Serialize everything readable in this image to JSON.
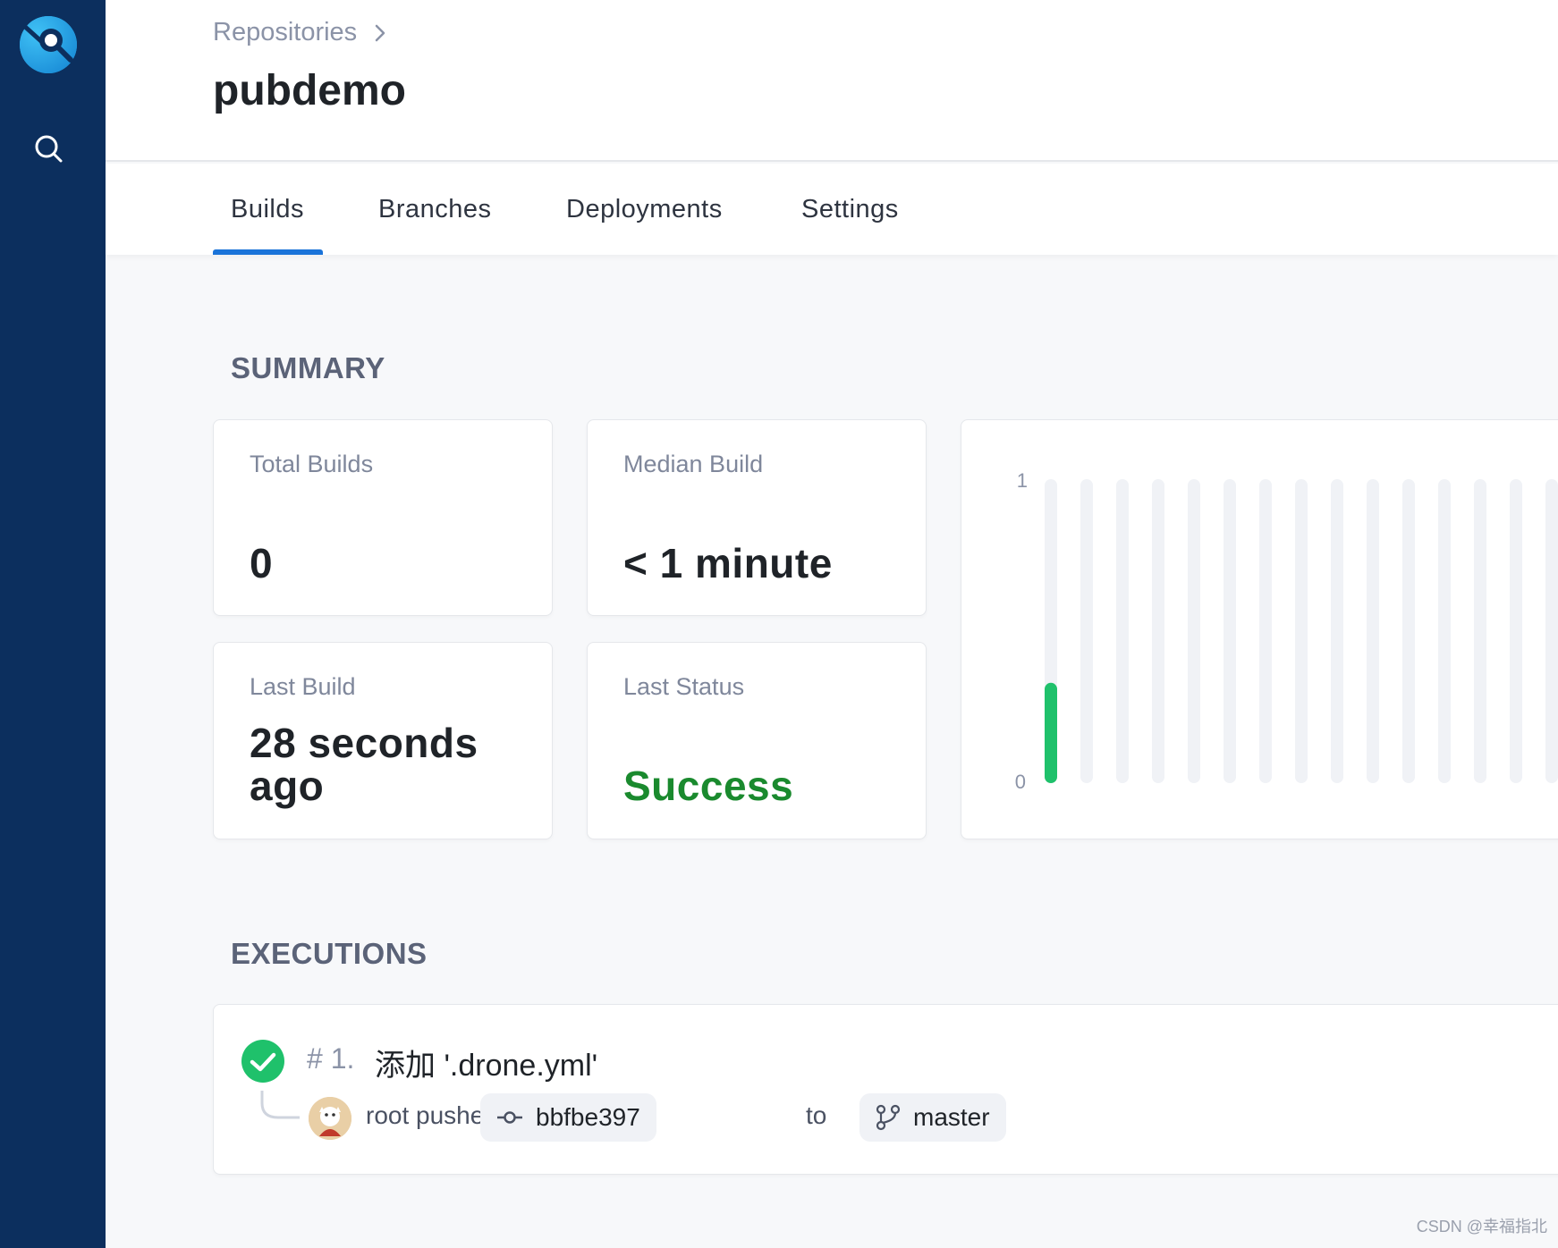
{
  "breadcrumb": {
    "parent": "Repositories",
    "separator": ">"
  },
  "repo": {
    "name": "pubdemo"
  },
  "tabs": [
    {
      "label": "Builds",
      "active": true
    },
    {
      "label": "Branches",
      "active": false
    },
    {
      "label": "Deployments",
      "active": false
    },
    {
      "label": "Settings",
      "active": false
    }
  ],
  "summary": {
    "title": "SUMMARY",
    "total_builds": {
      "label": "Total Builds",
      "value": "0"
    },
    "median_build": {
      "label": "Median Build",
      "value": "< 1 minute"
    },
    "last_build": {
      "label": "Last Build",
      "value": "28 seconds ago"
    },
    "last_status": {
      "label": "Last Status",
      "value": "Success"
    }
  },
  "chart_data": {
    "type": "bar",
    "ylim": [
      0,
      1
    ],
    "ytick_labels": [
      "1",
      "0"
    ],
    "values": [
      0.33,
      0,
      0,
      0,
      0,
      0,
      0,
      0,
      0,
      0,
      0,
      0,
      0,
      0,
      0
    ],
    "bar_color": "#1fc16b",
    "track_color": "#f0f2f6"
  },
  "executions": {
    "title": "EXECUTIONS",
    "items": [
      {
        "number": "# 1.",
        "message": "添加 '.drone.yml'",
        "status": "success",
        "actor_text": "root pushed",
        "commit": "bbfbe397",
        "to_text": "to",
        "branch": "master"
      }
    ]
  },
  "colors": {
    "sidebar": "#0c2f5e",
    "accent": "#1a73d9",
    "success": "#1a8a2e",
    "success_icon": "#1fc16b"
  },
  "watermark": "CSDN @幸福指北"
}
